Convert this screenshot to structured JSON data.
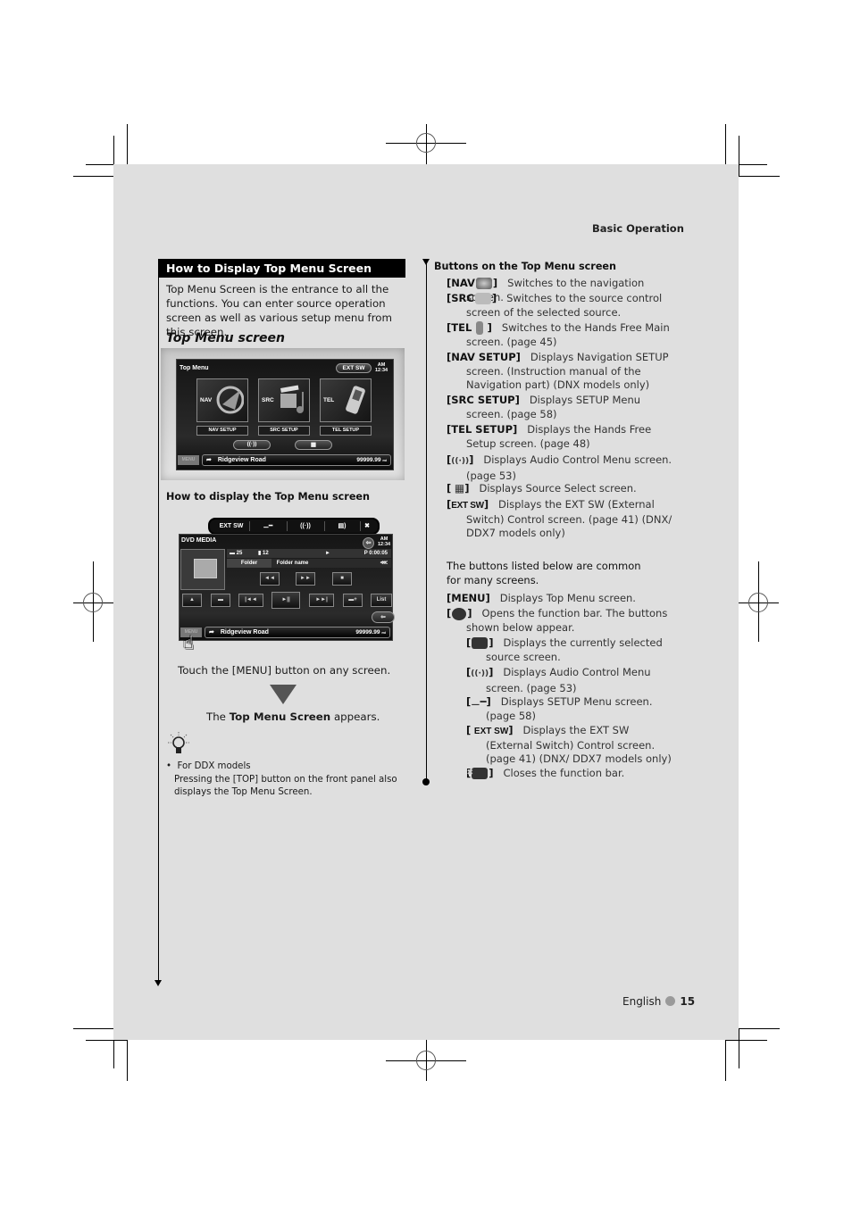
{
  "header": {
    "section": "Basic Operation"
  },
  "left": {
    "section_title": "How to Display Top Menu Screen",
    "intro": "Top Menu Screen is the entrance to all the functions. You can enter source operation screen as well as various setup menu from this screen.",
    "subsection_title": "Top Menu screen",
    "top_menu_screen": {
      "title": "Top Menu",
      "ext_sw": "EXT SW",
      "clock_ampm": "AM",
      "clock_time": "12:34",
      "buttons": [
        {
          "label": "NAV"
        },
        {
          "label": "SRC"
        },
        {
          "label": "TEL"
        }
      ],
      "setup_buttons": [
        {
          "label": "NAV SETUP"
        },
        {
          "label": "SRC SETUP"
        },
        {
          "label": "TEL SETUP"
        }
      ],
      "menu_label": "MENU",
      "road": "Ridgeview Road",
      "distance": "99999.99",
      "distance_unit": "mi"
    },
    "how_to_title": "How to display the Top Menu screen",
    "function_bar": {
      "ext_sw": "EXT SW"
    },
    "dvd_screen": {
      "title": "DVD MEDIA",
      "clock_ampm": "AM",
      "clock_time": "12:34",
      "folder_count": "25",
      "file_count": "12",
      "play_time": "P 0:00:05",
      "folder_label": "Folder",
      "folder_name": "Folder name",
      "list_label": "List",
      "menu_label": "MENU",
      "road": "Ridgeview Road",
      "distance": "99999.99",
      "distance_unit": "mi"
    },
    "step1": "Touch the [MENU] button on any screen.",
    "step2_pre": "The ",
    "step2_bold": "Top Menu Screen",
    "step2_post": " appears.",
    "note_title": "For DDX models",
    "note_body": "Pressing the [TOP] button on the front panel also displays the Top Menu Screen."
  },
  "right": {
    "heading": "Buttons on the Top Menu screen",
    "items": [
      {
        "key": "[NAV",
        "icon": "nav-icon",
        "close": "]",
        "text": "Switches to the navigation screen."
      },
      {
        "key": "[SRC",
        "icon": "src-icon",
        "close": "]",
        "text": "Switches to the source control screen of the selected source."
      },
      {
        "key": "[TEL",
        "icon": "phone-icon",
        "close": "]",
        "text": "Switches to the Hands Free Main screen. (page 45)"
      },
      {
        "key": "[NAV SETUP]",
        "text": "Displays Navigation SETUP screen. (Instruction manual of the Navigation part) (DNX models only)"
      },
      {
        "key": "[SRC SETUP]",
        "text": "Displays SETUP Menu screen. (page 58)"
      },
      {
        "key": "[TEL SETUP]",
        "text": "Displays the Hands Free Setup screen. (page 48)"
      },
      {
        "key": "[",
        "icon": "audio-icon",
        "close": "]",
        "text": "Displays Audio Control Menu screen. (page 53)"
      },
      {
        "key": "[",
        "icon": "source-select-icon",
        "close": "]",
        "text": "Displays Source Select screen."
      },
      {
        "key": "[",
        "icon_text": "EXT SW",
        "close": "]",
        "text": "Displays the EXT SW (External Switch) Control screen. (page 41) (DNX/ DDX7 models only)"
      }
    ],
    "common_intro": "The buttons listed below are common for many screens.",
    "common": [
      {
        "key": "[MENU]",
        "text": "Displays Top Menu screen."
      },
      {
        "key": "[",
        "icon": "function-bar-icon",
        "close": "]",
        "text": "Opens the function bar. The buttons shown below appear."
      }
    ],
    "sub_items": [
      {
        "icon": "current-source-icon",
        "text": "Displays the currently selected source screen."
      },
      {
        "icon": "audio-icon",
        "text": "Displays Audio Control Menu screen. (page 53)"
      },
      {
        "icon": "setup-wrench-icon",
        "text": "Displays SETUP Menu screen. (page 58)"
      },
      {
        "icon_text": "EXT SW",
        "text": "Displays the EXT SW (External Switch) Control screen. (page 41) (DNX/ DDX7 models only)"
      },
      {
        "icon": "close-icon",
        "text": "Closes the function bar."
      }
    ]
  },
  "footer": {
    "language": "English",
    "page": "15"
  }
}
